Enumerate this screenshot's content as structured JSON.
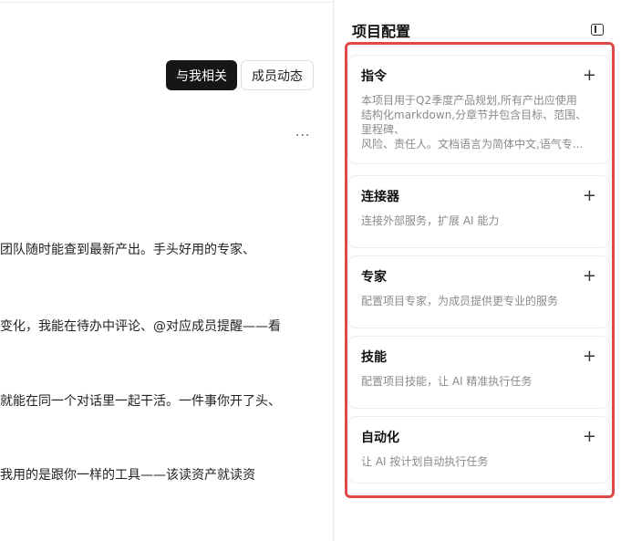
{
  "left": {
    "tabs": [
      {
        "label": "与我相关",
        "active": true
      },
      {
        "label": "成员动态",
        "active": false
      }
    ],
    "more_label": "···",
    "chat_lines": [
      "团队随时能查到最新产出。手头好用的专家、",
      "变化，我能在待办中评论、@对应成员提醒——看",
      "就能在同一个对话里一起干活。一件事你开了头、",
      "我用的是跟你一样的工具——该读资产就读资"
    ]
  },
  "right": {
    "title": "项目配置",
    "toggle_icon": "sidebar-toggle-icon",
    "highlight_color": "#e0484a",
    "cards": [
      {
        "title": "指令",
        "desc_lines": [
          "本项目用于Q2季度产品规划,所有产出应使用",
          "结构化markdown,分章节并包含目标、范围、",
          "里程碑、",
          "风险、责任人。文档语言为简体中文,语气专..."
        ]
      },
      {
        "title": "连接器",
        "desc_lines": [
          "连接外部服务，扩展 AI 能力"
        ]
      },
      {
        "title": "专家",
        "desc_lines": [
          "配置项目专家，为成员提供更专业的服务"
        ]
      },
      {
        "title": "技能",
        "desc_lines": [
          "配置项目技能，让 AI 精准执行任务"
        ]
      },
      {
        "title": "自动化",
        "desc_lines": [
          "让 AI 按计划自动执行任务"
        ]
      }
    ],
    "plus_glyph": "+"
  }
}
